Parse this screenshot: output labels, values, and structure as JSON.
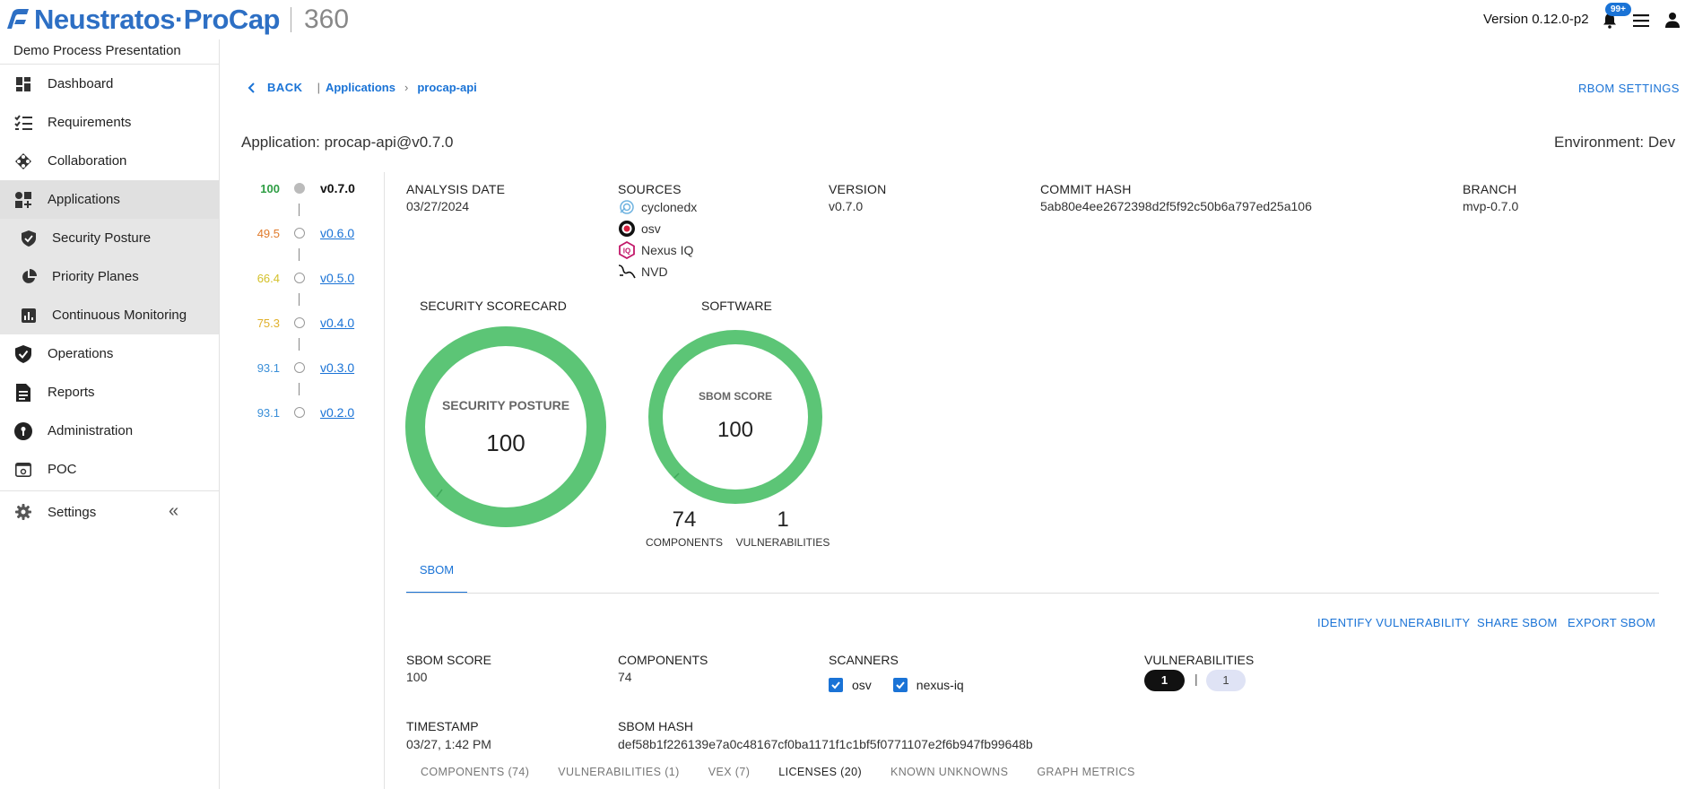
{
  "header": {
    "brand": "Neustratos·ProCap",
    "product": "360",
    "version": "Version 0.12.0-p2",
    "notifications_badge": "99+"
  },
  "sidebar": {
    "project": "Demo Process Presentation",
    "items": [
      {
        "label": "Dashboard",
        "icon": "dashboard-icon"
      },
      {
        "label": "Requirements",
        "icon": "checklist-icon"
      },
      {
        "label": "Collaboration",
        "icon": "collaboration-icon"
      },
      {
        "label": "Applications",
        "icon": "applications-icon"
      },
      {
        "label": "Security Posture",
        "icon": "shield-icon"
      },
      {
        "label": "Priority Planes",
        "icon": "pie-chart-icon"
      },
      {
        "label": "Continuous Monitoring",
        "icon": "bar-chart-icon"
      },
      {
        "label": "Operations",
        "icon": "shield-check-icon"
      },
      {
        "label": "Reports",
        "icon": "document-icon"
      },
      {
        "label": "Administration",
        "icon": "keyhole-icon"
      },
      {
        "label": "POC",
        "icon": "screen-icon"
      }
    ],
    "settings": "Settings",
    "collapse": "«"
  },
  "breadcrumb": {
    "back": "BACK",
    "sep": "|",
    "applications": "Applications",
    "arrow": "›",
    "current": "procap-api"
  },
  "rbom_settings": "RBOM SETTINGS",
  "app_title": "Application: procap-api@v0.7.0",
  "environment": "Environment: Dev",
  "timeline": [
    {
      "score": "100",
      "version": "v0.7.0",
      "color": "#2e9e44",
      "current": true
    },
    {
      "score": "49.5",
      "version": "v0.6.0",
      "color": "#e07a2a",
      "current": false
    },
    {
      "score": "66.4",
      "version": "v0.5.0",
      "color": "#d4c12a",
      "current": false
    },
    {
      "score": "75.3",
      "version": "v0.4.0",
      "color": "#e0b02a",
      "current": false
    },
    {
      "score": "93.1",
      "version": "v0.3.0",
      "color": "#3a8fd8",
      "current": false
    },
    {
      "score": "93.1",
      "version": "v0.2.0",
      "color": "#3a8fd8",
      "current": false
    }
  ],
  "info": {
    "analysis_date_label": "ANALYSIS DATE",
    "analysis_date": "03/27/2024",
    "sources_label": "SOURCES",
    "sources": [
      {
        "name": "cyclonedx",
        "icon": "cyclonedx-icon"
      },
      {
        "name": "osv",
        "icon": "osv-icon"
      },
      {
        "name": "Nexus IQ",
        "icon": "nexus-iq-icon"
      },
      {
        "name": "NVD",
        "icon": "nvd-icon"
      }
    ],
    "version_label": "VERSION",
    "version": "v0.7.0",
    "commit_label": "COMMIT HASH",
    "commit": "5ab80e4ee2672398d2f5f92c50b6a797ed25a106",
    "branch_label": "BRANCH",
    "branch": "mvp-0.7.0"
  },
  "scorecard": {
    "title": "SECURITY SCORECARD",
    "label": "SECURITY POSTURE",
    "value": "100",
    "fill_fraction": 1.0,
    "color": "#5cc576"
  },
  "software": {
    "title": "SOFTWARE",
    "label": "SBOM SCORE",
    "value": "100",
    "fill_fraction": 1.0,
    "components_count": "74",
    "components_label": "COMPONENTS",
    "vulnerabilities_count": "1",
    "vulnerabilities_label": "VULNERABILITIES"
  },
  "tab": "SBOM",
  "actions": {
    "identify": "IDENTIFY VULNERABILITY",
    "share": "SHARE SBOM",
    "export": "EXPORT SBOM"
  },
  "sbom": {
    "score_label": "SBOM SCORE",
    "score": "100",
    "components_label": "COMPONENTS",
    "components": "74",
    "scanners_label": "SCANNERS",
    "scanner1": "osv",
    "scanner2": "nexus-iq",
    "vulns_label": "VULNERABILITIES",
    "vuln_dark": "1",
    "vuln_sep": "|",
    "vuln_light": "1",
    "timestamp_label": "TIMESTAMP",
    "timestamp": "03/27, 1:42 PM",
    "hash_label": "SBOM HASH",
    "hash": "def58b1f226139e7a0c48167cf0ba1171f1c1bf5f0771107e2f6b947fb99648b"
  },
  "subtabs": [
    {
      "label": "COMPONENTS (74)",
      "active": false
    },
    {
      "label": "VULNERABILITIES (1)",
      "active": false
    },
    {
      "label": "VEX (7)",
      "active": false
    },
    {
      "label": "LICENSES (20)",
      "active": true
    },
    {
      "label": "KNOWN UNKNOWNS",
      "active": false
    },
    {
      "label": "GRAPH METRICS",
      "active": false
    }
  ]
}
